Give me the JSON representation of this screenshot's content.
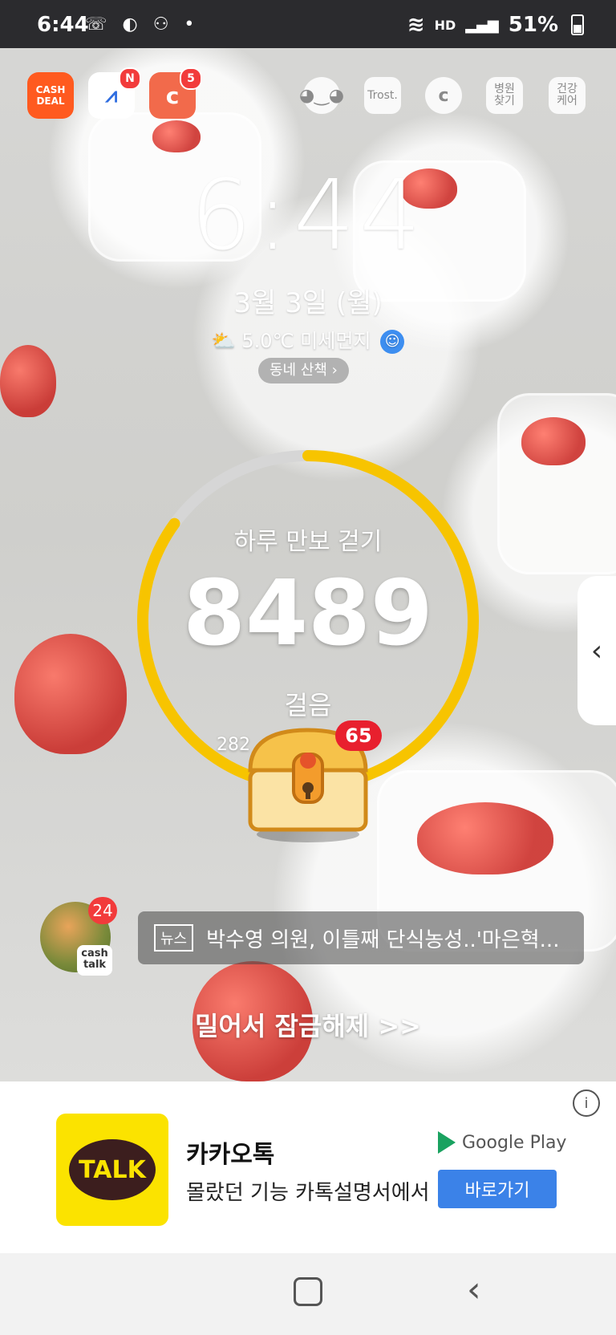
{
  "status": {
    "time": "6:44",
    "left_icons": "☏ ◐ ⚇ •",
    "network": "HD",
    "signal": "▂▄▆",
    "battery": "51%"
  },
  "apps": {
    "cash_deal": "CASH DEAL",
    "app2_badge": "N",
    "app3_badge": "5",
    "trost": "Trost.",
    "hospital": "병원\n찾기",
    "health": "건강\n케어"
  },
  "lock": {
    "clock": "6:44",
    "date": "3월 3일 (월)",
    "weather": "5.0℃ 미세먼지",
    "walk_pill": "동네 산책  ›"
  },
  "steps": {
    "title": "하루 만보 걷기",
    "count": "8489",
    "unit": "걸음",
    "sub": "282",
    "progress": 0.85,
    "chest_badge": "65"
  },
  "cashtalk": {
    "label": "cash\ntalk",
    "badge": "24"
  },
  "news": {
    "tag": "뉴스",
    "headline": "박수영 의원, 이틀째 단식농성..'마은혁..."
  },
  "unlock_text": "밀어서 잠금해제 >>",
  "ad": {
    "info": "i",
    "logo": "TALK",
    "title": "카카오톡",
    "desc": "몰랐던 기능 카톡설명서에서",
    "store": "Google Play",
    "button": "바로가기"
  },
  "colors": {
    "ring": "#f7c400",
    "ring_track": "#d6d6d6",
    "badge_red": "#f23b3b",
    "kakao_yellow": "#fbe300",
    "button_blue": "#3b82e8"
  }
}
